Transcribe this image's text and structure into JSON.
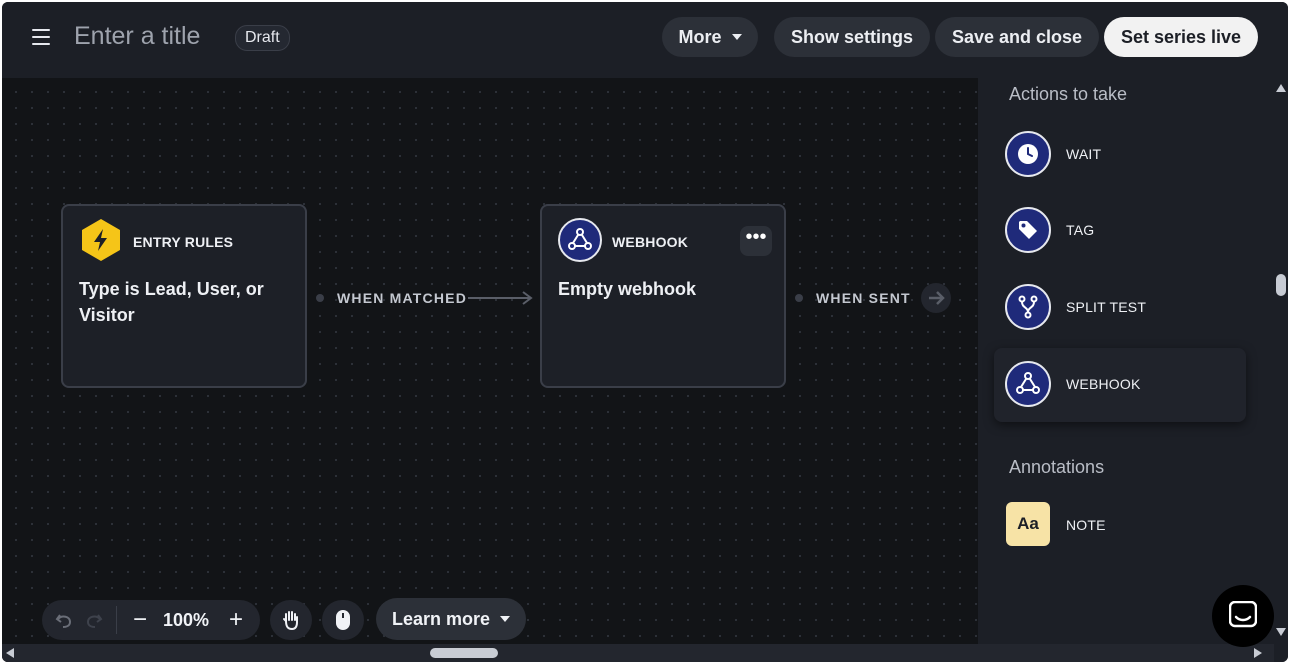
{
  "header": {
    "menu_icon": "hamburger-icon",
    "title_placeholder": "Enter a title",
    "status_badge": "Draft",
    "more_label": "More",
    "show_settings_label": "Show settings",
    "save_close_label": "Save and close",
    "set_live_label": "Set series live"
  },
  "canvas": {
    "entry_node": {
      "kind": "ENTRY RULES",
      "body": "Type is Lead, User, or Visitor",
      "icon": "lightning-icon",
      "icon_color": "#f5c518"
    },
    "edge1_label": "WHEN MATCHED",
    "webhook_node": {
      "kind": "WEBHOOK",
      "body": "Empty webhook",
      "icon": "webhook-icon",
      "menu": "•••"
    },
    "edge2_label": "WHEN SENT"
  },
  "toolbar": {
    "zoom_out": "−",
    "zoom_level": "100%",
    "zoom_in": "+",
    "learn_more_label": "Learn more"
  },
  "panel": {
    "actions_title": "Actions to take",
    "actions": [
      {
        "label": "WAIT",
        "icon": "clock-icon"
      },
      {
        "label": "TAG",
        "icon": "tag-icon"
      },
      {
        "label": "SPLIT TEST",
        "icon": "split-icon"
      },
      {
        "label": "WEBHOOK",
        "icon": "webhook-icon"
      }
    ],
    "annotations_title": "Annotations",
    "note_label": "NOTE",
    "note_icon_text": "Aa"
  },
  "colors": {
    "accent_navy": "#1f2a7a",
    "entry_yellow": "#f5c518",
    "note_yellow": "#f7e3a6"
  }
}
